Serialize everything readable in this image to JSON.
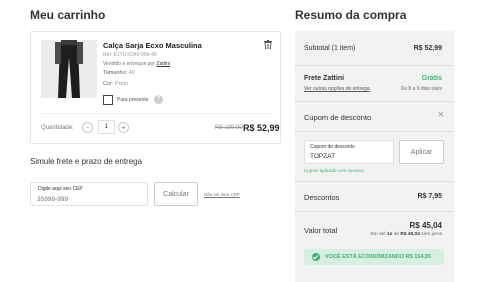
{
  "cart": {
    "title": "Meu carrinho",
    "product": {
      "name": "Calça Sarja Ecxo Masculina",
      "ref": "Ref: K1YU-0340-066-40",
      "sold_by_prefix": "Vendido e entregue por",
      "sold_by": "Zattini",
      "size_label": "Tamanho:",
      "size_value": "40",
      "color_label": "Cor:",
      "color_value": "Preto",
      "gift_label": "Para presente",
      "help_glyph": "?",
      "quantity_label": "Quantidade:",
      "quantity": "1",
      "minus_glyph": "−",
      "plus_glyph": "+",
      "old_price": "R$ 199,90",
      "price": "R$ 52,99"
    },
    "shipping": {
      "title": "Simule frete e prazo de entrega",
      "cep_label": "Digite aqui seu CEP",
      "cep_placeholder": "35999-999",
      "calc_button": "Calcular",
      "no_cep_link": "Não sei meu CEP"
    }
  },
  "summary": {
    "title": "Resumo da compra",
    "subtotal_label": "Subtotal (1 item)",
    "subtotal_value": "R$ 52,99",
    "frete_label": "Frete Zattini",
    "frete_value": "Grátis",
    "frete_link": "Ver outras opções de entrega",
    "frete_days": "De 8 a 9 dias úteis",
    "cupom_label": "Cupom de desconto",
    "cupom_close": "×",
    "coupon_field_label": "Cupom de desconto",
    "coupon_value": "TOPZAT",
    "apply_button": "Aplicar",
    "coupon_success": "Cupom aplicado com sucesso",
    "discount_label": "Descontos",
    "discount_value": "R$ 7,95",
    "total_label": "Valor total",
    "total_value": "R$ 45,04",
    "installment_prefix": "Em até",
    "installment_times": "1x",
    "installment_mid": "de",
    "installment_amount": "R$ 45,04",
    "installment_suffix": "sem juros",
    "savings_text": "VOCÊ ESTÁ ECONOMIZANDO R$ 154,95"
  },
  "colors": {
    "accent_green": "#3cb371",
    "panel_bg": "#f2f2f2",
    "savings_bg": "#d6efe1"
  },
  "icons": {
    "trash": "trash-icon",
    "help": "help-icon",
    "close": "close-icon",
    "check": "check-circle-icon"
  }
}
